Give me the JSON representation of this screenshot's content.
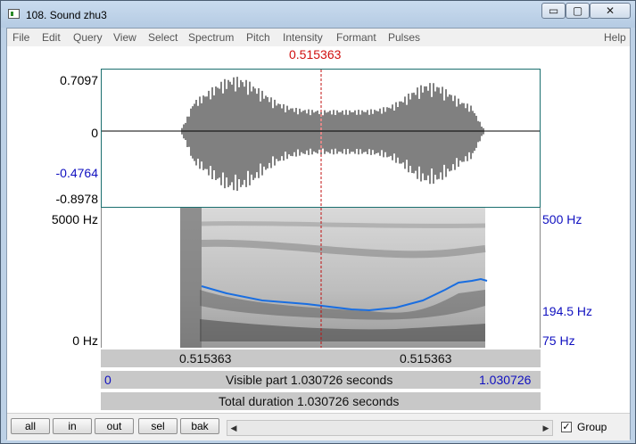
{
  "window": {
    "title": "108. Sound zhu3"
  },
  "titlebar_buttons": {
    "minimize": "▭",
    "maximize": "▢",
    "close": "✕"
  },
  "menu": [
    "File",
    "Edit",
    "Query",
    "View",
    "Select",
    "Spectrum",
    "Pitch",
    "Intensity",
    "Formant",
    "Pulses",
    "Help"
  ],
  "cursor": {
    "time": "0.515363"
  },
  "waveform": {
    "y_max": "0.7097",
    "y_zero": "0",
    "y_cursor": "-0.4764",
    "y_min": "-0.8978"
  },
  "spectrogram": {
    "freq_top": "5000 Hz",
    "freq_bottom": "0 Hz",
    "pitch_top": "500 Hz",
    "pitch_value": "194.5 Hz",
    "pitch_bottom": "75 Hz"
  },
  "time_bars": {
    "left_segment": "0.515363",
    "right_segment": "0.515363",
    "visible_start": "0",
    "visible_text": "Visible part 1.030726 seconds",
    "visible_end": "1.030726",
    "total_text": "Total duration 1.030726 seconds"
  },
  "buttons": {
    "all": "all",
    "in": "in",
    "out": "out",
    "sel": "sel",
    "bak": "bak"
  },
  "scrollbar": {
    "left_arrow": "◀",
    "right_arrow": "▶"
  },
  "group": {
    "label": "Group",
    "checked": true,
    "check_mark": "✓"
  },
  "colors": {
    "cursor": "#d01010",
    "pitch_curve": "#1a6ee0",
    "axis_blue": "#1010c0"
  }
}
